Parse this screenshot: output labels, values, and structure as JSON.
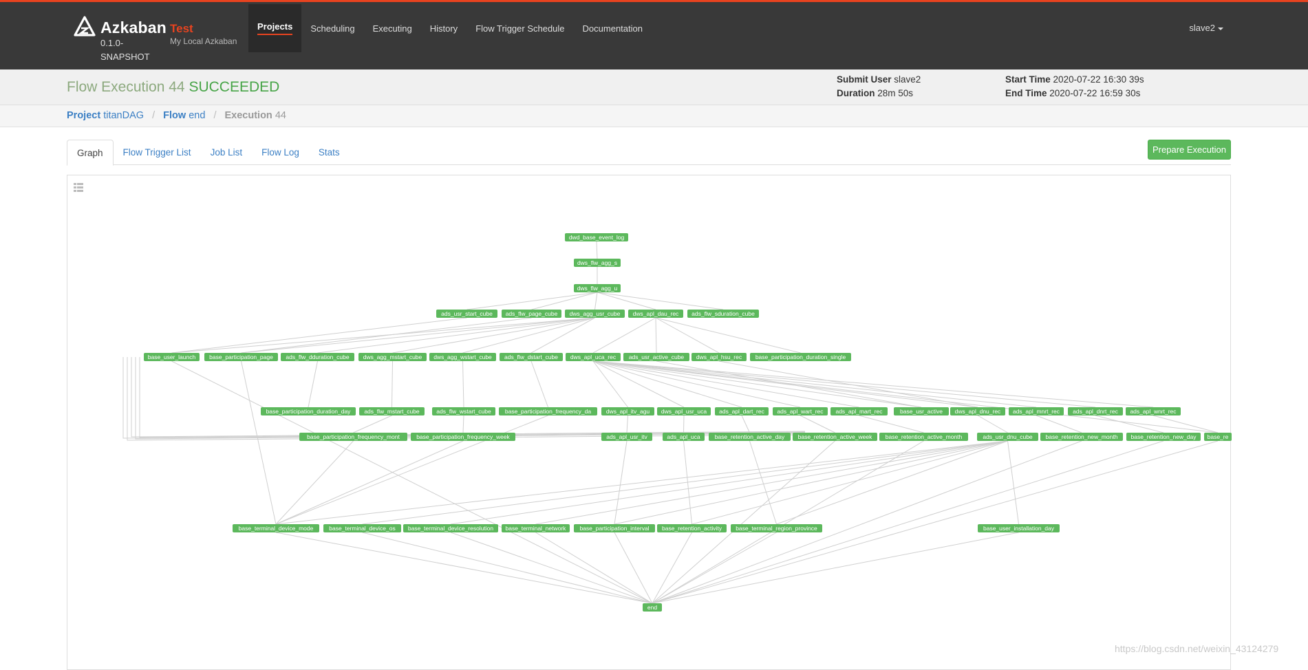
{
  "app": {
    "brand": "Azkaban",
    "version": "0.1.0-SNAPSHOT",
    "env_name": "Test",
    "env_desc": "My Local Azkaban"
  },
  "nav": {
    "items": [
      "Projects",
      "Scheduling",
      "Executing",
      "History",
      "Flow Trigger Schedule",
      "Documentation"
    ],
    "active": "Projects",
    "user": "slave2"
  },
  "execution": {
    "title_prefix": "Flow Execution 44",
    "status": "SUCCEEDED",
    "submit_user_label": "Submit User",
    "submit_user": "slave2",
    "duration_label": "Duration",
    "duration": "28m 50s",
    "start_time_label": "Start Time",
    "start_time": "2020-07-22 16:30 39s",
    "end_time_label": "End Time",
    "end_time": "2020-07-22 16:59 30s"
  },
  "breadcrumb": {
    "project_label": "Project",
    "project": "titanDAG",
    "flow_label": "Flow",
    "flow": "end",
    "execution_label": "Execution",
    "execution": "44"
  },
  "tabs": [
    "Graph",
    "Flow Trigger List",
    "Job List",
    "Flow Log",
    "Stats"
  ],
  "prepare_button": "Prepare Execution",
  "watermark": "https://blog.csdn.net/weixin_43124279",
  "colors": {
    "topbar": "#393939",
    "accent": "#e8431f",
    "success": "#5cb85c",
    "edge": "#cfcfcf"
  },
  "graph": {
    "node_status": "SUCCEEDED",
    "nodes": [
      "dwd_base_event_log",
      "dws_flw_agg_s",
      "dws_flw_agg_u",
      "ads_usr_start_cube",
      "ads_flw_page_cube",
      "dws_agg_usr_cube",
      "dws_apl_dau_rec",
      "ads_flw_sduration_cube",
      "base_user_launch",
      "base_participation_page",
      "ads_flw_dduration_cube",
      "dws_agg_mstart_cube",
      "dws_agg_wstart_cube",
      "ads_flw_dstart_cube",
      "dws_apl_uca_rec",
      "ads_usr_active_cube",
      "dws_apl_hsu_rec",
      "base_participation_duration_single",
      "base_participation_duration_day",
      "ads_flw_mstart_cube",
      "ads_flw_wstart_cube",
      "base_participation_frequency_da",
      "dws_apl_itv_agu",
      "dws_apl_usr_uca",
      "ads_apl_dart_rec",
      "ads_apl_wart_rec",
      "ads_apl_mart_rec",
      "base_usr_active",
      "dws_apl_dnu_rec",
      "ads_apl_mnrt_rec",
      "ads_apl_dnrt_rec",
      "ads_apl_wnrt_rec",
      "base_participation_frequency_mont",
      "base_participation_frequency_week",
      "ads_apl_usr_itv",
      "ads_apl_uca",
      "base_retention_active_day",
      "base_retention_active_week",
      "base_retention_active_month",
      "ads_usr_dnu_cube",
      "base_retention_new_month",
      "base_retention_new_day",
      "base_re",
      "base_terminal_device_mode",
      "base_terminal_device_os",
      "base_terminal_device_resolution",
      "base_terminal_network",
      "base_participation_interval",
      "base_retention_activity",
      "base_terminal_region_province",
      "base_user_installation_day",
      "end"
    ]
  }
}
